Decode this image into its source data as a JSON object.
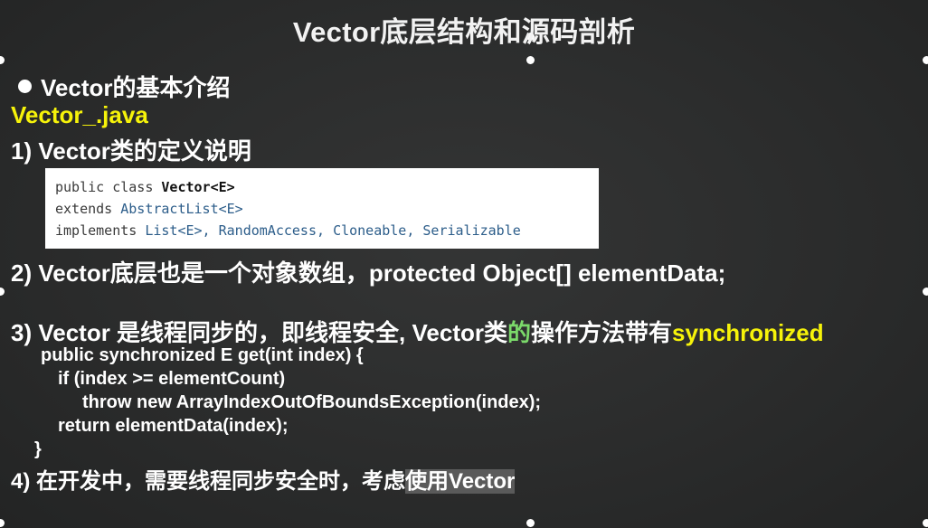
{
  "slide": {
    "title": "Vector底层结构和源码剖析",
    "bullet": "Vector的基本介绍",
    "filename": "Vector_.java",
    "point1": "1) Vector类的定义说明",
    "code": {
      "line1_a": "public class ",
      "line1_b": "Vector<E>",
      "line2_a": "extends ",
      "line2_b": "AbstractList<E>",
      "line3_a": "implements ",
      "line3_b": "List<E>, ",
      "line3_c": "RandomAccess, ",
      "line3_d": "Cloneable, ",
      "line3_e": "Serializable"
    },
    "point2": "2) Vector底层也是一个对象数组，protected Object[] elementData;",
    "point3_a": "3) Vector 是线程同步的，即线程安全, Vector类",
    "point3_b": "的",
    "point3_c": "操作方法带有",
    "point3_d": "synchronized",
    "source": {
      "l1": "public synchronized E get(int index) {",
      "l2": "if (index >= elementCount)",
      "l3": "throw new ArrayIndexOutOfBoundsException(index);",
      "l4": "return elementData(index);",
      "l5": "}"
    },
    "point4_a": "4)  在开发中，需要线程同步安全时，考虑",
    "point4_b": "使用Vector"
  }
}
